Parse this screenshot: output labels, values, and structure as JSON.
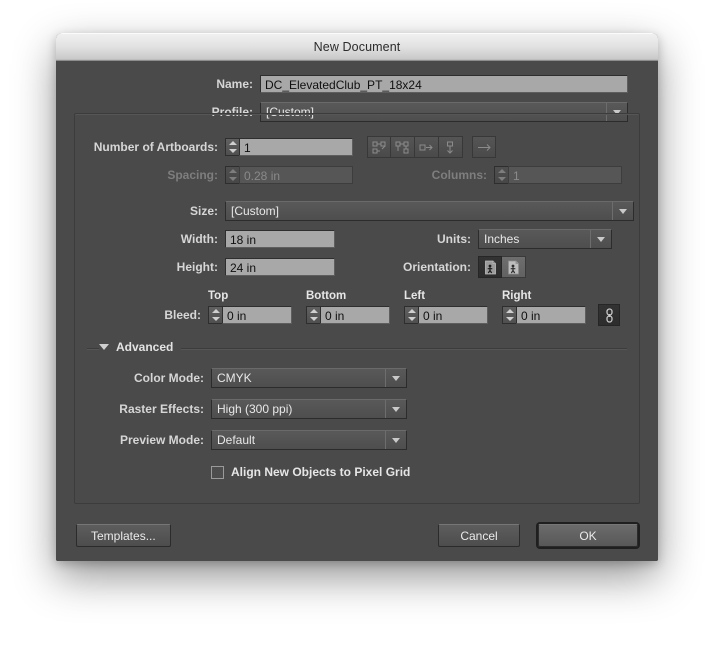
{
  "window": {
    "title": "New Document"
  },
  "form": {
    "name_label": "Name:",
    "name_value": "DC_ElevatedClub_PT_18x24",
    "profile_label": "Profile:",
    "profile_value": "[Custom]",
    "artboards_label": "Number of Artboards:",
    "artboards_value": "1",
    "spacing_label": "Spacing:",
    "spacing_value": "0.28 in",
    "columns_label": "Columns:",
    "columns_value": "1",
    "size_label": "Size:",
    "size_value": "[Custom]",
    "width_label": "Width:",
    "width_value": "18 in",
    "units_label": "Units:",
    "units_value": "Inches",
    "height_label": "Height:",
    "height_value": "24 in",
    "orientation_label": "Orientation:",
    "bleed_label": "Bleed:",
    "bleed_top_header": "Top",
    "bleed_bottom_header": "Bottom",
    "bleed_left_header": "Left",
    "bleed_right_header": "Right",
    "bleed_top_value": "0 in",
    "bleed_bottom_value": "0 in",
    "bleed_left_value": "0 in",
    "bleed_right_value": "0 in"
  },
  "advanced": {
    "section_title": "Advanced",
    "color_mode_label": "Color Mode:",
    "color_mode_value": "CMYK",
    "raster_label": "Raster Effects:",
    "raster_value": "High (300 ppi)",
    "preview_label": "Preview Mode:",
    "preview_value": "Default",
    "align_pixel_label": "Align New Objects to Pixel Grid",
    "align_pixel_checked": false
  },
  "footer": {
    "templates_label": "Templates...",
    "cancel_label": "Cancel",
    "ok_label": "OK"
  },
  "icons": {
    "artboard_grid_rows": "artboard-grid-by-row-icon",
    "artboard_grid_cols": "artboard-grid-by-column-icon",
    "artboard_row": "artboard-arrange-row-icon",
    "artboard_col": "artboard-arrange-column-icon",
    "artboard_direction": "artboard-right-to-left-icon",
    "orientation_portrait": "orientation-portrait-icon",
    "orientation_landscape": "orientation-landscape-icon",
    "bleed_link": "bleed-link-chain-icon"
  },
  "colors": {
    "dialog_bg": "#4a4a4a",
    "field_bg": "#a8a8a8",
    "title_text": "#2c2c2c"
  }
}
